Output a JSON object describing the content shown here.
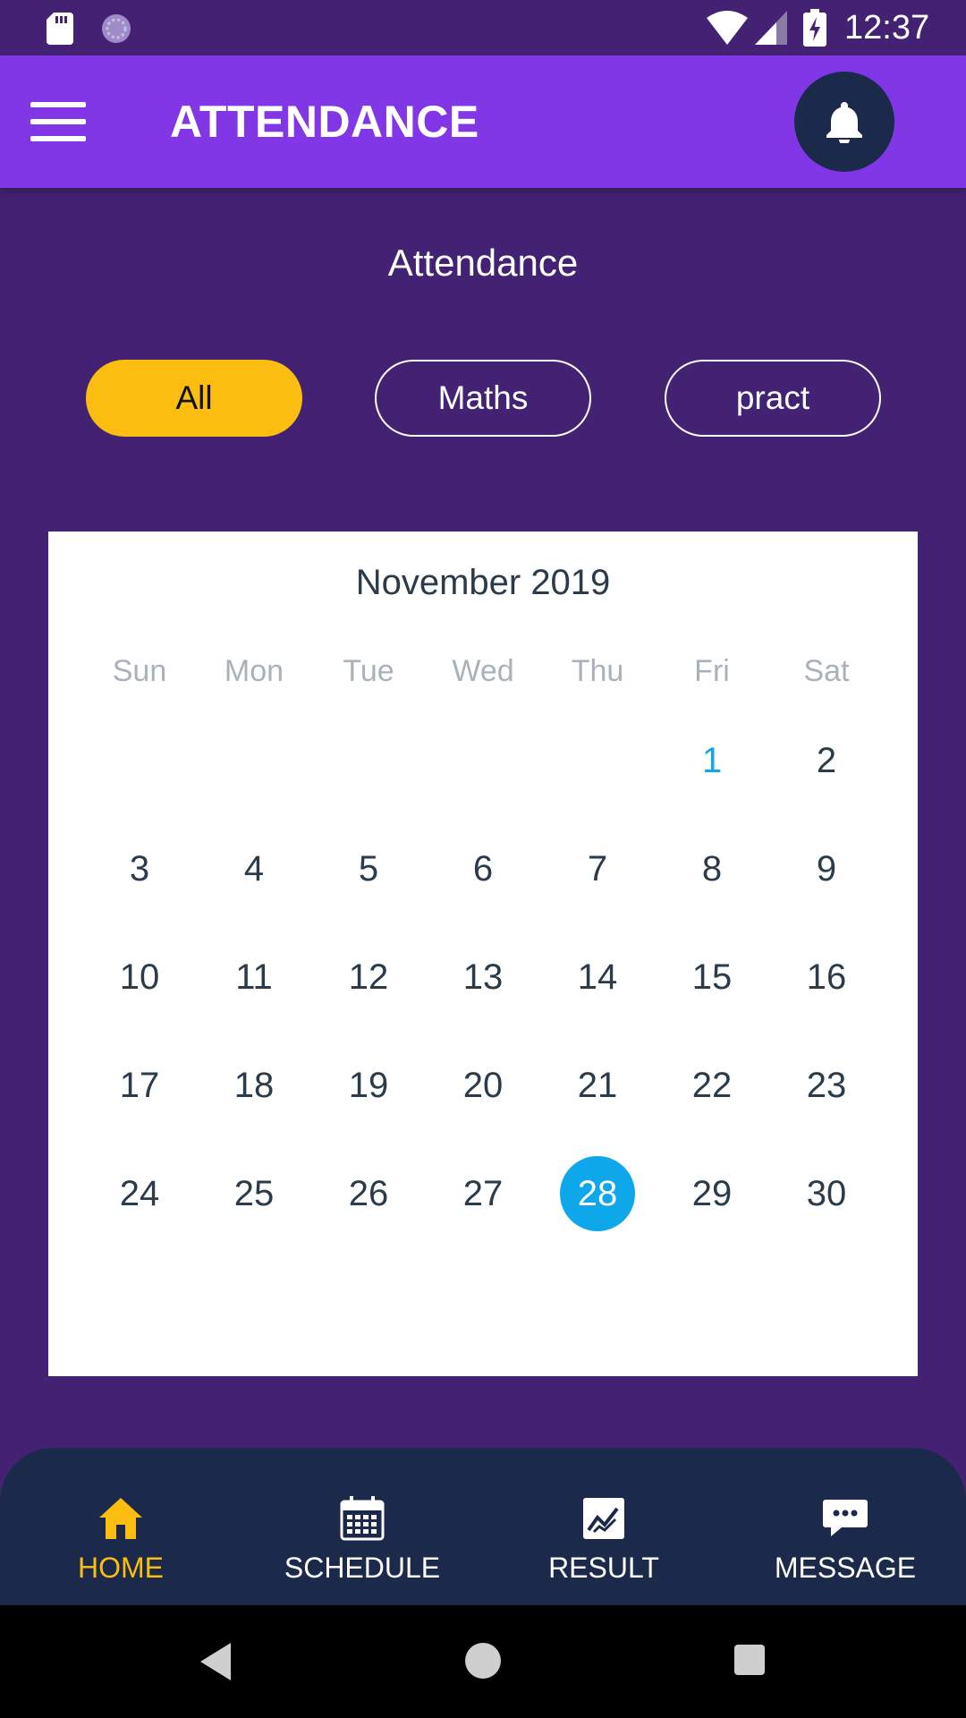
{
  "status_bar": {
    "time": "12:37",
    "icons": [
      "sd-card-icon",
      "sync-icon",
      "wifi-icon",
      "cell-signal-icon",
      "battery-charging-icon"
    ]
  },
  "app_bar": {
    "title": "ATTENDANCE",
    "menu_icon": "hamburger-menu-icon",
    "bell_icon": "bell-icon",
    "background_color": "#8237e6"
  },
  "section": {
    "title": "Attendance"
  },
  "filters": {
    "items": [
      {
        "label": "All",
        "active": true
      },
      {
        "label": "Maths",
        "active": false
      },
      {
        "label": "pract",
        "active": false
      }
    ],
    "active_color": "#fbbd10"
  },
  "calendar": {
    "month_title": "November 2019",
    "weekdays": [
      "Sun",
      "Mon",
      "Tue",
      "Wed",
      "Thu",
      "Fri",
      "Sat"
    ],
    "weeks": [
      [
        "",
        "",
        "",
        "",
        "",
        "1",
        "2"
      ],
      [
        "3",
        "4",
        "5",
        "6",
        "7",
        "8",
        "9"
      ],
      [
        "10",
        "11",
        "12",
        "13",
        "14",
        "15",
        "16"
      ],
      [
        "17",
        "18",
        "19",
        "20",
        "21",
        "22",
        "23"
      ],
      [
        "24",
        "25",
        "26",
        "27",
        "28",
        "29",
        "30"
      ]
    ],
    "highlighted_day": "1",
    "selected_day": "28",
    "selected_color": "#0ea8ea"
  },
  "bottom_nav": {
    "items": [
      {
        "label": "HOME",
        "icon": "home-icon",
        "active": true
      },
      {
        "label": "SCHEDULE",
        "icon": "calendar-icon",
        "active": false
      },
      {
        "label": "RESULT",
        "icon": "chart-icon",
        "active": false
      },
      {
        "label": "MESSAGE",
        "icon": "message-icon",
        "active": false
      }
    ],
    "active_color": "#fbbd10"
  },
  "colors": {
    "background": "#432273",
    "nav_background": "#1b2a4a"
  }
}
